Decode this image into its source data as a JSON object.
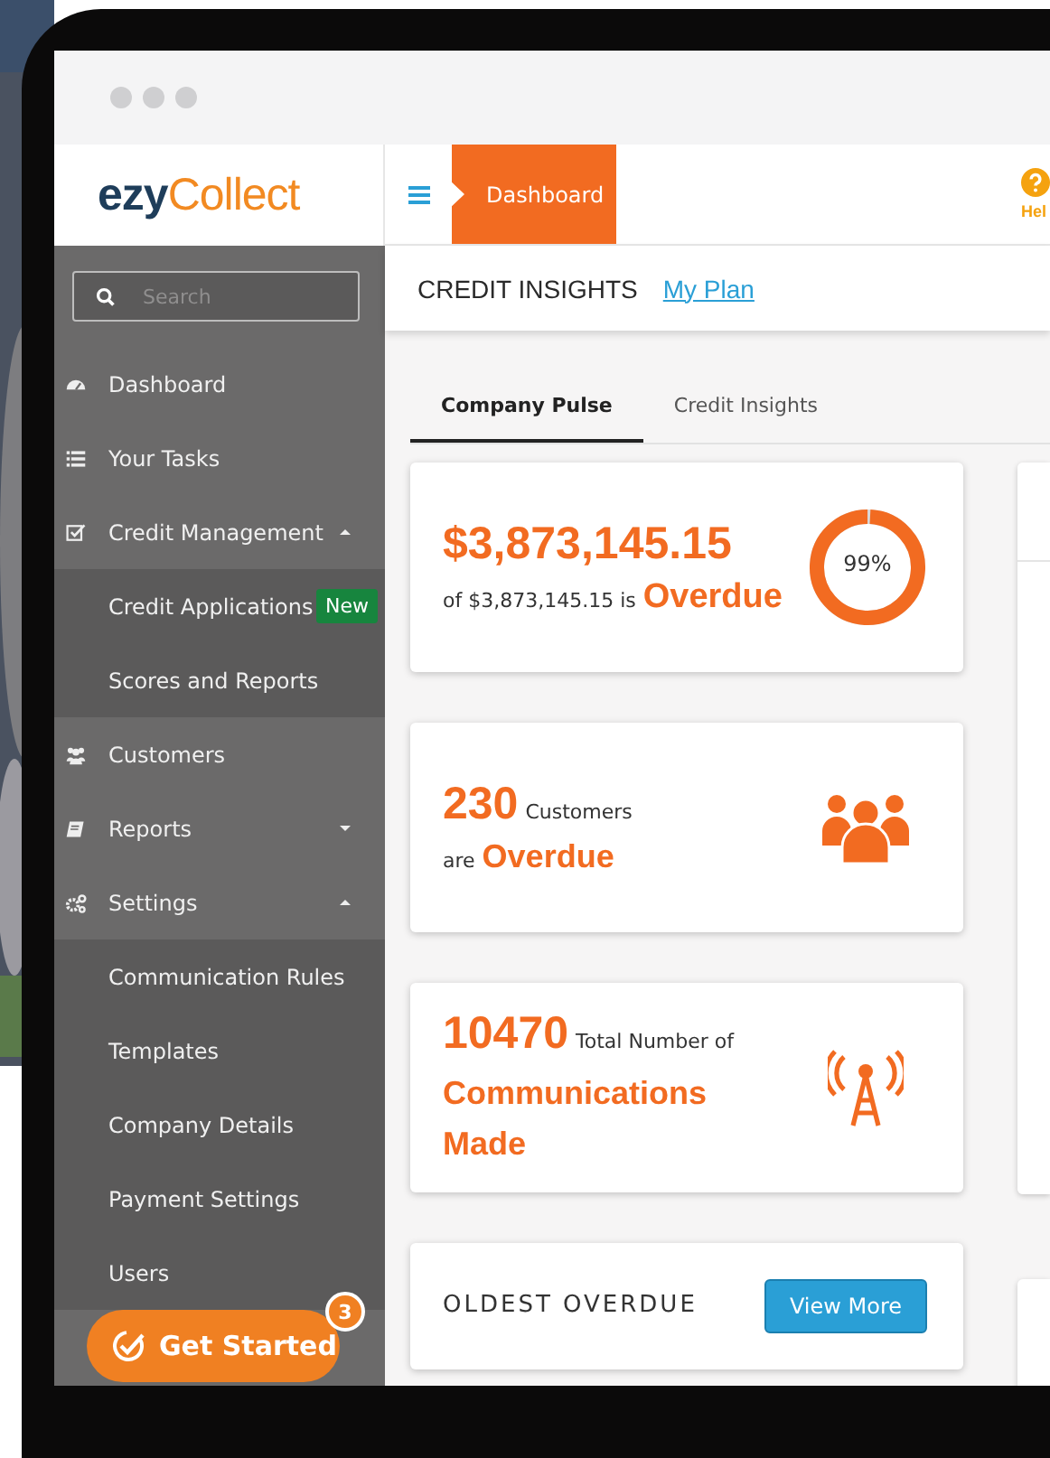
{
  "logo": {
    "prefix": "ezy",
    "suffix": "Collect"
  },
  "search": {
    "placeholder": "Search"
  },
  "sidebar": {
    "items": [
      {
        "label": "Dashboard"
      },
      {
        "label": "Your Tasks"
      },
      {
        "label": "Credit Management",
        "expanded": true,
        "children": [
          {
            "label": "Credit Applications",
            "badge": "New"
          },
          {
            "label": "Scores and Reports"
          }
        ]
      },
      {
        "label": "Customers"
      },
      {
        "label": "Reports",
        "expanded": false
      },
      {
        "label": "Settings",
        "expanded": true,
        "children": [
          {
            "label": "Communication Rules"
          },
          {
            "label": "Templates"
          },
          {
            "label": "Company Details"
          },
          {
            "label": "Payment Settings"
          },
          {
            "label": "Users"
          }
        ]
      }
    ]
  },
  "topbar": {
    "breadcrumb": "Dashboard",
    "help": "Hel"
  },
  "header": {
    "title": "CREDIT INSIGHTS",
    "link": "My Plan"
  },
  "tabs": [
    {
      "label": "Company Pulse",
      "selected": true
    },
    {
      "label": "Credit Insights",
      "selected": false
    }
  ],
  "cards": [
    {
      "kind": "amount",
      "value": "$3,873,145.15",
      "text": "of $3,873,145.15 is",
      "highlight": "Overdue",
      "reading": "99%",
      "level": 0.99
    },
    {
      "kind": "customers",
      "value": "230",
      "text": "Customers",
      "prefix": "are",
      "highlight": "Overdue"
    },
    {
      "kind": "communications",
      "value": "10470",
      "text": "Total Number of",
      "highlight": "Communications Made"
    },
    {
      "kind": "list",
      "title": "OLDEST OVERDUE",
      "button": "View More"
    }
  ],
  "get_started": {
    "label": "Get Started",
    "badge": "3"
  }
}
